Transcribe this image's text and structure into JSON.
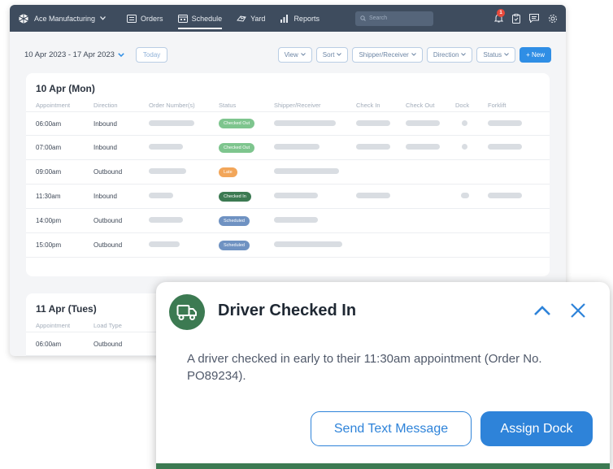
{
  "colors": {
    "nav_bg": "#3e4c5e",
    "accent_blue": "#2e83d9",
    "toast_green": "#3c7a52",
    "status_checked_out": "#7ec58e",
    "status_late": "#f2a65a",
    "status_checked_in": "#3c7a52",
    "status_scheduled": "#6f92c2"
  },
  "nav": {
    "brand": "Ace Manufacturing",
    "items": [
      {
        "label": "Orders",
        "icon": "orders-icon"
      },
      {
        "label": "Schedule",
        "icon": "calendar-icon"
      },
      {
        "label": "Yard",
        "icon": "truck-icon"
      },
      {
        "label": "Reports",
        "icon": "chart-icon"
      }
    ],
    "search_placeholder": "Search",
    "notification_count": "1"
  },
  "toolbar": {
    "date_range": "10 Apr 2023 - 17 Apr 2023",
    "today": "Today",
    "filters": [
      "View",
      "Sort",
      "Shipper/Receiver",
      "Direction",
      "Status"
    ],
    "new": "+ New"
  },
  "schedule": {
    "columns": [
      "Appointment",
      "Direction",
      "Order Number(s)",
      "Status",
      "Shipper/Receiver",
      "Check In",
      "Check Out",
      "Dock",
      "Forklift"
    ],
    "day1": {
      "title": "10 Apr (Mon)",
      "rows": [
        {
          "time": "06:00am",
          "direction": "Inbound",
          "status": "Checked Out",
          "status_color": "#7ec58e"
        },
        {
          "time": "07:00am",
          "direction": "Inbound",
          "status": "Checked Out",
          "status_color": "#7ec58e"
        },
        {
          "time": "09:00am",
          "direction": "Outbound",
          "status": "Late",
          "status_color": "#f2a65a"
        },
        {
          "time": "11:30am",
          "direction": "Inbound",
          "status": "Checked In",
          "status_color": "#3c7a52"
        },
        {
          "time": "14:00pm",
          "direction": "Outbound",
          "status": "Scheduled",
          "status_color": "#6f92c2"
        },
        {
          "time": "15:00pm",
          "direction": "Outbound",
          "status": "Scheduled",
          "status_color": "#6f92c2"
        }
      ]
    },
    "day2": {
      "title": "11 Apr  (Tues)",
      "columns": [
        "Appointment",
        "Load Type"
      ],
      "rows": [
        {
          "time": "06:00am",
          "direction": "Outbound"
        }
      ]
    }
  },
  "toast": {
    "icon": "truck-icon",
    "title": "Driver Checked In",
    "body": "A driver checked in early to their 11:30am appointment (Order No. PO89234).",
    "send_text": "Send Text Message",
    "assign_dock": "Assign Dock"
  }
}
